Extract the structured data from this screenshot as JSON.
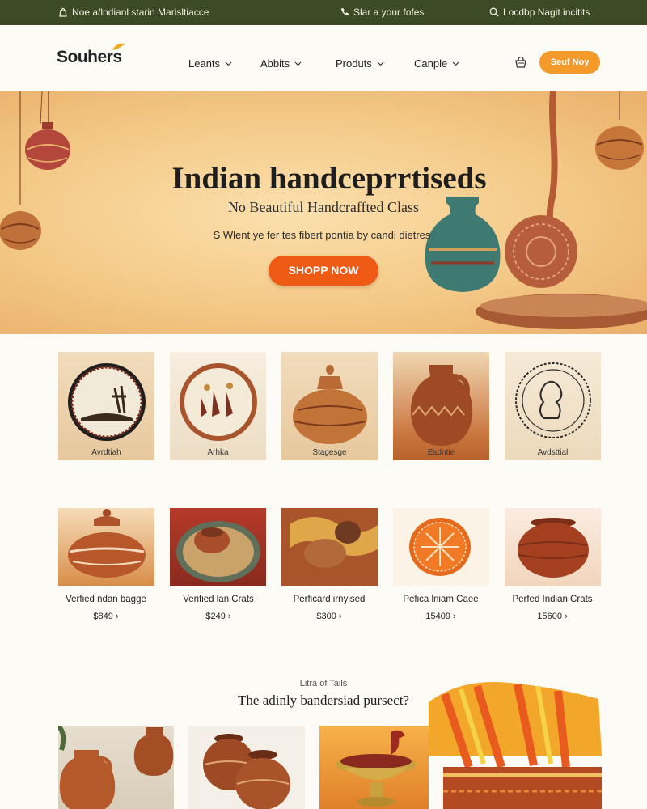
{
  "topbar": {
    "left": "Noe a/lndianl starin Marisltiacce",
    "center": "Slar a your fofes",
    "right": "Locdbp Nagit incitits"
  },
  "header": {
    "logo": "Souhers",
    "nav": [
      "Leants",
      "Abbits",
      "Produts",
      "Canple"
    ],
    "cta": "Seuf Noy"
  },
  "hero": {
    "title": "Indian handceprrtiseds",
    "subtitle": "No Beautiful Handcraffted Class",
    "description": "S Wlent ye fer tes fibert pontia by candi dietres",
    "button": "SHOPP NOW"
  },
  "categories": [
    {
      "label": "Avrdtiah"
    },
    {
      "label": "Arhka"
    },
    {
      "label": "Stagesge"
    },
    {
      "label": "Esdntie"
    },
    {
      "label": "Avdsttial"
    }
  ],
  "products": [
    {
      "name": "Verfied ndan bagge",
      "price": "$849 ›"
    },
    {
      "name": "Verified lan Crats",
      "price": "$249 ›"
    },
    {
      "name": "Perficard irnyised",
      "price": "$300 ›"
    },
    {
      "name": "Pefica lniam Caee",
      "price": "15409 ›"
    },
    {
      "name": "Perfed Indian Crats",
      "price": "15600 ›"
    }
  ],
  "section": {
    "eyebrow": "Litra of Tails",
    "title": "The adinly bandersiad pursect?"
  },
  "colors": {
    "topbar": "#3d4a26",
    "accent_orange": "#ef5a14",
    "header_button": "#f39a2b",
    "terracotta": "#b8582a"
  }
}
